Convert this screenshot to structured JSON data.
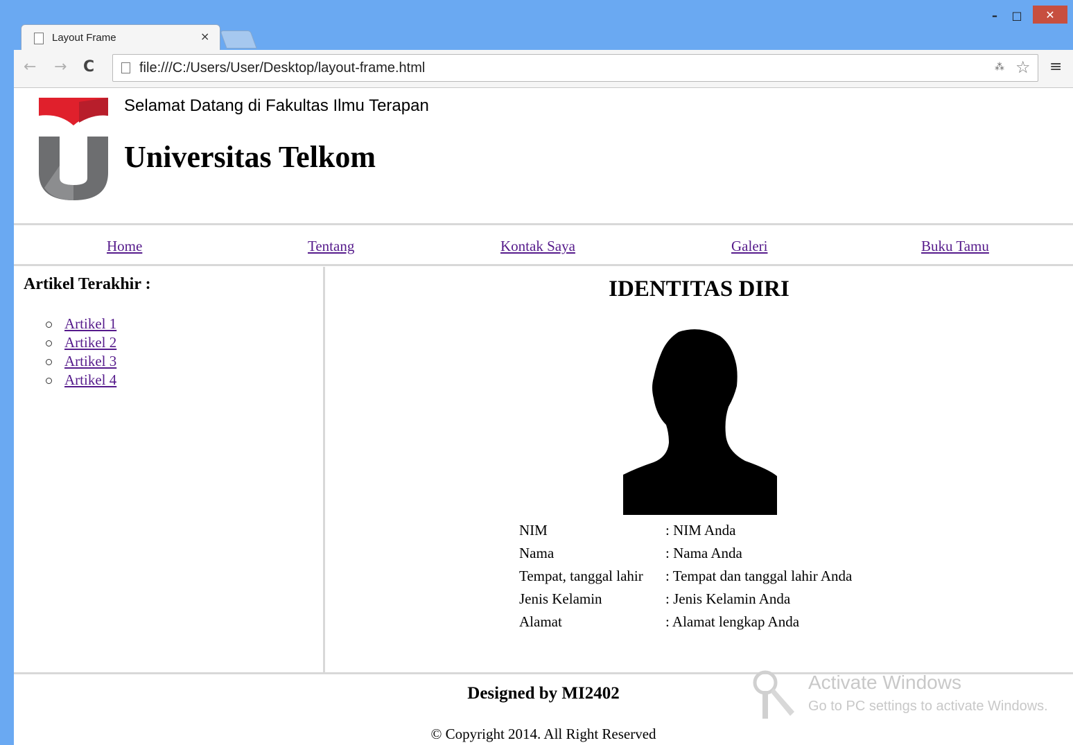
{
  "browser": {
    "tab_title": "Layout Frame",
    "tab_close": "×",
    "url": "file:///C:/Users/User/Desktop/layout-frame.html",
    "back": "←",
    "forward": "→",
    "reload": "C",
    "star": "☆",
    "menu": "≡",
    "translate": "⁂",
    "window_min": "–",
    "window_max": "□",
    "window_close": "✕"
  },
  "header": {
    "welcome": "Selamat Datang di Fakultas Ilmu Terapan",
    "brand": "Universitas Telkom"
  },
  "nav": {
    "items": [
      "Home",
      "Tentang",
      "Kontak Saya",
      "Galeri",
      "Buku Tamu"
    ]
  },
  "sidebar": {
    "title": "Artikel Terakhir :",
    "articles": [
      "Artikel 1",
      "Artikel 2",
      "Artikel 3",
      "Artikel 4"
    ]
  },
  "main": {
    "title": "IDENTITAS DIRI",
    "rows": [
      {
        "label": "NIM",
        "value": ": NIM Anda"
      },
      {
        "label": "Nama",
        "value": ": Nama Anda"
      },
      {
        "label": "Tempat, tanggal lahir",
        "value": ": Tempat dan tanggal lahir Anda"
      },
      {
        "label": "Jenis Kelamin",
        "value": ": Jenis Kelamin Anda"
      },
      {
        "label": "Alamat",
        "value": ": Alamat lengkap Anda"
      }
    ]
  },
  "footer": {
    "title": "Designed by MI2402",
    "copyright": "© Copyright 2014. All Right Reserved"
  },
  "watermark": {
    "title": "Activate Windows",
    "subtitle": "Go to PC settings to activate Windows."
  },
  "colors": {
    "chrome_frame": "#6aa9f2",
    "visited_link": "#551a8b",
    "close_button": "#c74f3f",
    "logo_red": "#e0202c",
    "logo_grey": "#6d6e70"
  }
}
